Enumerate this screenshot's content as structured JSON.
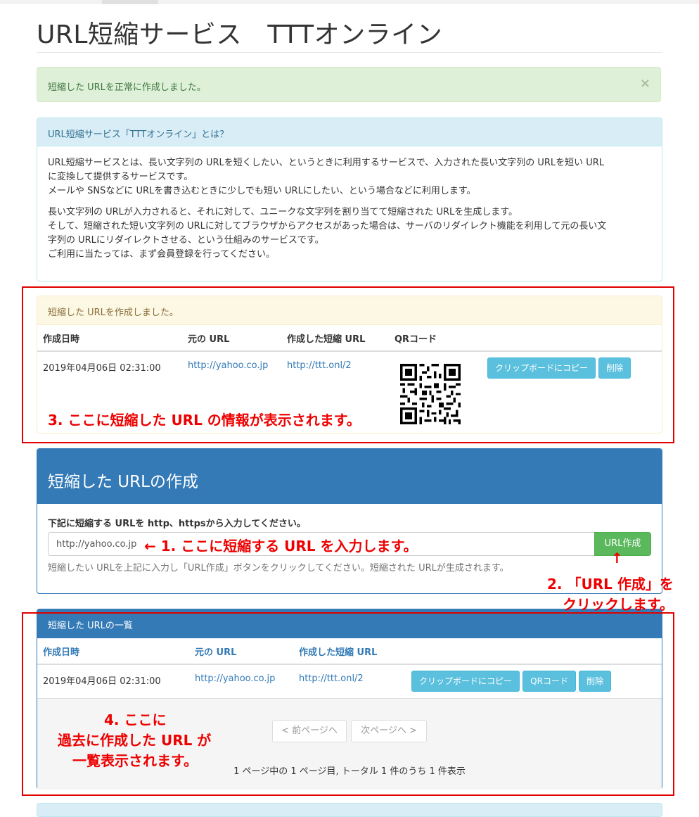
{
  "page": {
    "title": "URL短縮サービス　TTTオンライン"
  },
  "alert": {
    "message": "短縮した URLを正常に作成しました。",
    "close": "×"
  },
  "about": {
    "heading": "URL短縮サービス「TTTオンライン」とは？",
    "para1_line1": "URL短縮サービスとは、長い文字列の URLを短くしたい、というときに利用するサービスで、入力された長い文字列の URLを短い URL",
    "para1_line2": "に変換して提供するサービスです。",
    "para1_line3": "メールや SNSなどに URLを書き込むときに少しでも短い URLにしたい、という場合などに利用します。",
    "para2_line1": "長い文字列の URLが入力されると、それに対して、ユニークな文字列を割り当てて短縮された URLを生成します。",
    "para2_line2": "そして、短縮された短い文字列の URLに対してブラウザからアクセスがあった場合は、サーバのリダイレクト機能を利用して元の長い文",
    "para2_line3": "字列の URLにリダイレクトさせる、という仕組みのサービスです。",
    "para2_line4": "ご利用に当たっては、まず会員登録を行ってください。"
  },
  "created": {
    "heading": "短縮した URLを作成しました。",
    "columns": [
      "作成日時",
      "元の URL",
      "作成した短縮 URL",
      "QRコード"
    ],
    "row": {
      "date": "2019年04月06日 02:31:00",
      "original": "http://yahoo.co.jp",
      "short": "http://ttt.onl/2"
    },
    "copy_label": "クリップボードにコピー",
    "delete_label": "削除"
  },
  "form": {
    "heading": "短縮した URLの作成",
    "label": "下記に短縮する URLを http、httpsから入力してください。",
    "input_value": "http://yahoo.co.jp",
    "button": "URL作成",
    "help": "短縮したい URLを上記に入力し「URL作成」ボタンをクリックしてください。短縮された URLが生成されます。"
  },
  "list": {
    "heading": "短縮した URLの一覧",
    "columns": [
      "作成日時",
      "元の URL",
      "作成した短縮 URL"
    ],
    "row": {
      "date": "2019年04月06日 02:31:00",
      "original": "http://yahoo.co.jp",
      "short": "http://ttt.onl/2"
    },
    "copy_label": "クリップボードにコピー",
    "qr_label": "QRコード",
    "delete_label": "削除",
    "prev": "< 前ページへ",
    "next": "次ページへ >",
    "info": "1 ページ中の 1 ページ目, トータル 1 件のうち 1 件表示"
  },
  "annotations": {
    "a1": "←  1.   ここに短縮する URL を入力します。",
    "a2_arrow": "↑",
    "a2_line1": "2. 「URL 作成」を",
    "a2_line2": "クリックします。",
    "a3": "3.   ここに短縮した URL の情報が表示されます。",
    "a4_line1": "4.  ここに",
    "a4_line2": "過去に作成した URL が",
    "a4_line3": "一覧表示されます。"
  },
  "colors": {
    "primary": "#337ab7",
    "info_button": "#5bc0de",
    "success_button": "#5cb85c",
    "annotation_red": "#ee0000"
  }
}
